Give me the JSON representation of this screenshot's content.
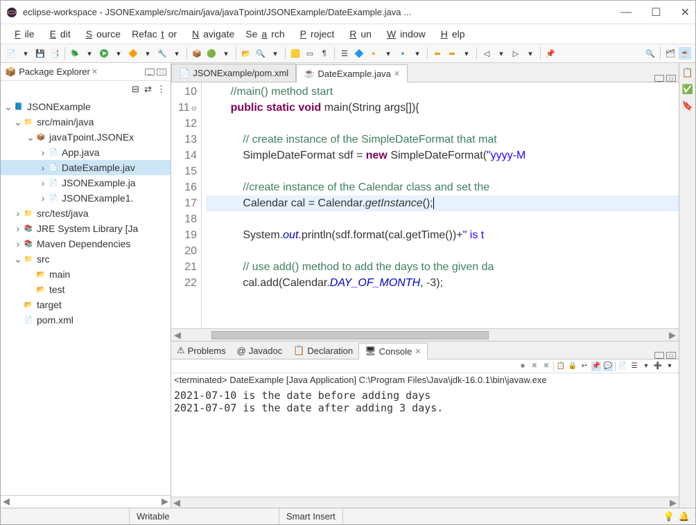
{
  "title": "eclipse-workspace - JSONExample/src/main/java/javaTpoint/JSONExample/DateExample.java ...",
  "menu": [
    "File",
    "Edit",
    "Source",
    "Refactor",
    "Navigate",
    "Search",
    "Project",
    "Run",
    "Window",
    "Help"
  ],
  "packageExplorer": {
    "title": "Package Explorer",
    "tree": [
      {
        "d": 0,
        "exp": "v",
        "ico": "proj",
        "label": "JSONExample"
      },
      {
        "d": 1,
        "exp": "v",
        "ico": "srcfolder",
        "label": "src/main/java"
      },
      {
        "d": 2,
        "exp": "v",
        "ico": "pkg",
        "label": "javaTpoint.JSONEx"
      },
      {
        "d": 3,
        "exp": ">",
        "ico": "java",
        "label": "App.java"
      },
      {
        "d": 3,
        "exp": ">",
        "ico": "java",
        "label": "DateExample.jav",
        "sel": true
      },
      {
        "d": 3,
        "exp": ">",
        "ico": "java",
        "label": "JSONExample.ja"
      },
      {
        "d": 3,
        "exp": ">",
        "ico": "java",
        "label": "JSONExample1."
      },
      {
        "d": 1,
        "exp": ">",
        "ico": "srcfolder",
        "label": "src/test/java"
      },
      {
        "d": 1,
        "exp": ">",
        "ico": "lib",
        "label": "JRE System Library [Ja"
      },
      {
        "d": 1,
        "exp": ">",
        "ico": "lib",
        "label": "Maven Dependencies"
      },
      {
        "d": 1,
        "exp": "v",
        "ico": "srcfolder",
        "label": "src"
      },
      {
        "d": 2,
        "exp": "",
        "ico": "folder",
        "label": "main"
      },
      {
        "d": 2,
        "exp": "",
        "ico": "folder",
        "label": "test"
      },
      {
        "d": 1,
        "exp": "",
        "ico": "folder",
        "label": "target"
      },
      {
        "d": 1,
        "exp": "",
        "ico": "file",
        "label": "pom.xml"
      }
    ]
  },
  "editor": {
    "tabs": [
      {
        "label": "JSONExample/pom.xml",
        "active": false
      },
      {
        "label": "DateExample.java",
        "active": true
      }
    ],
    "lines": [
      10,
      11,
      12,
      13,
      14,
      15,
      16,
      17,
      18,
      19,
      20,
      21,
      22
    ],
    "code": [
      {
        "t": "cm",
        "txt": "//main() method start",
        "indent": 2
      },
      {
        "t": "sig",
        "indent": 2
      },
      {
        "t": "",
        "txt": "",
        "indent": 0
      },
      {
        "t": "cm",
        "txt": "// create instance of the SimpleDateFormat that mat",
        "indent": 3
      },
      {
        "t": "sdf",
        "indent": 3
      },
      {
        "t": "",
        "txt": "",
        "indent": 0
      },
      {
        "t": "cm",
        "txt": "//create instance of the Calendar class and set the",
        "indent": 3
      },
      {
        "t": "cal",
        "indent": 3,
        "hl": true
      },
      {
        "t": "",
        "txt": "",
        "indent": 0
      },
      {
        "t": "out",
        "indent": 3
      },
      {
        "t": "",
        "txt": "",
        "indent": 0
      },
      {
        "t": "cm",
        "txt": "// use add() method to add the days to the given da",
        "indent": 3
      },
      {
        "t": "add",
        "indent": 3
      }
    ],
    "sigParts": {
      "kw1": "public static void",
      "mname": " main(String args[]){"
    },
    "sdfParts": {
      "p1": "SimpleDateFormat sdf = ",
      "kw": "new",
      "p2": " SimpleDateFormat(",
      "str": "\"yyyy-M"
    },
    "calParts": {
      "p1": "Calendar cal = Calendar.",
      "mth": "getInstance",
      "p2": "();"
    },
    "outParts": {
      "p1": "System.",
      "fld": "out",
      "p2": ".println(sdf.format(cal.getTime())+",
      "str": "\" is t"
    },
    "addParts": {
      "p1": "cal.add(Calendar.",
      "fld": "DAY_OF_MONTH",
      "p2": ", -3);"
    }
  },
  "bottom": {
    "tabs": [
      "Problems",
      "Javadoc",
      "Declaration",
      "Console"
    ],
    "activeTab": 3,
    "info": "<terminated> DateExample [Java Application] C:\\Program Files\\Java\\jdk-16.0.1\\bin\\javaw.exe",
    "output": "2021-07-10 is the date before adding days\n2021-07-07 is the date after adding 3 days."
  },
  "status": {
    "writable": "Writable",
    "insert": "Smart Insert"
  }
}
